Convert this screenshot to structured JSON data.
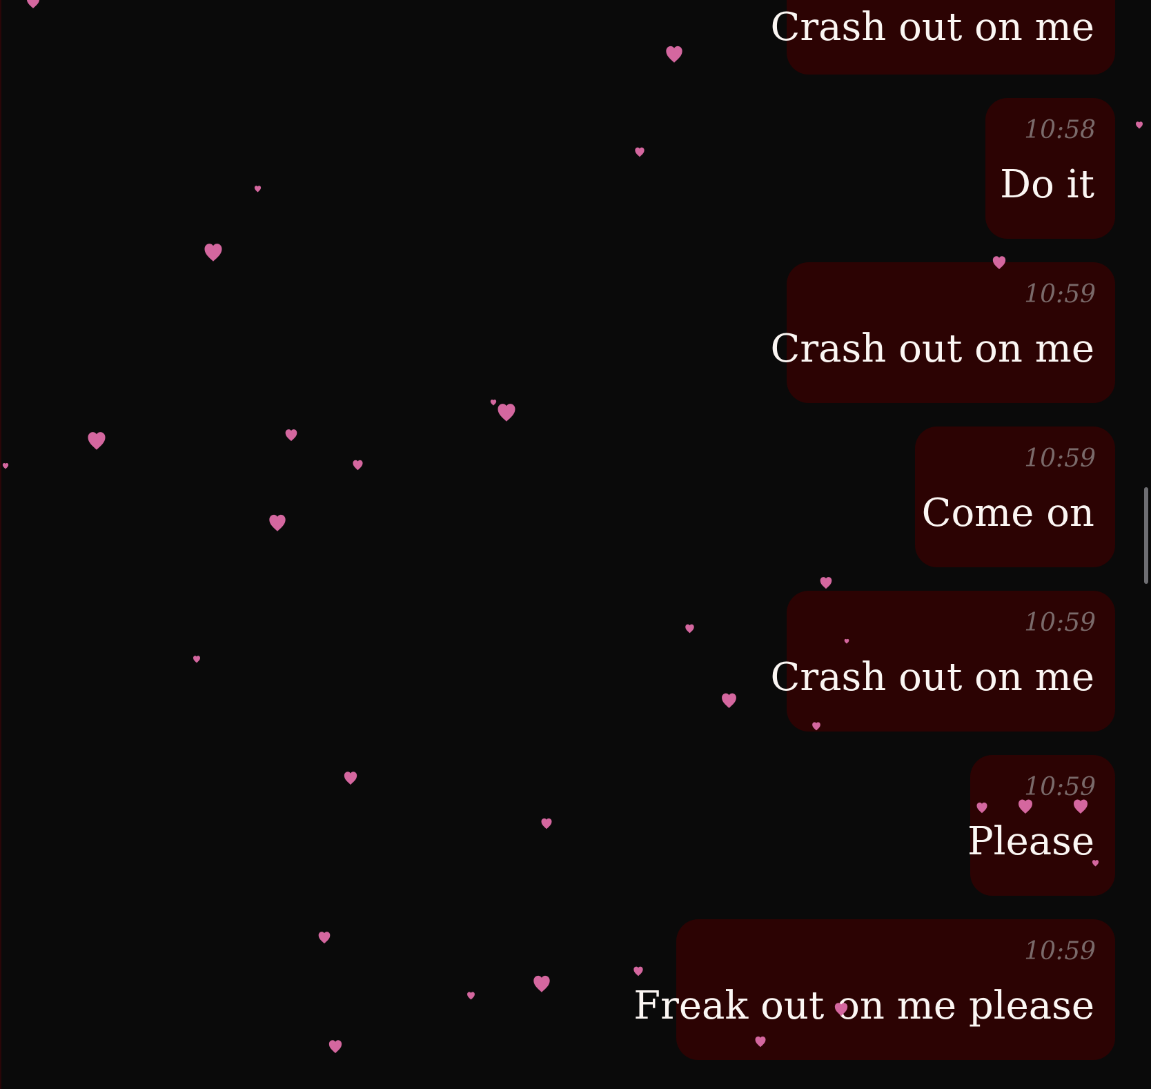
{
  "conversation": {
    "messages": [
      {
        "time": "",
        "text": "Crash out on me"
      },
      {
        "time": "10:58",
        "text": "Do it"
      },
      {
        "time": "10:59",
        "text": "Crash out on me"
      },
      {
        "time": "10:59",
        "text": "Come on"
      },
      {
        "time": "10:59",
        "text": "Crash out on me"
      },
      {
        "time": "10:59",
        "text": "Please"
      },
      {
        "time": "10:59",
        "text": "Freak out on me please"
      }
    ]
  },
  "theme": {
    "background": "#0a0a0a",
    "bubble": "#2c0303",
    "heart": "#d4679f",
    "timestamp": "#7a6a6a",
    "text": "#fbf6f3"
  },
  "decoration": {
    "icon": "heart-icon"
  }
}
